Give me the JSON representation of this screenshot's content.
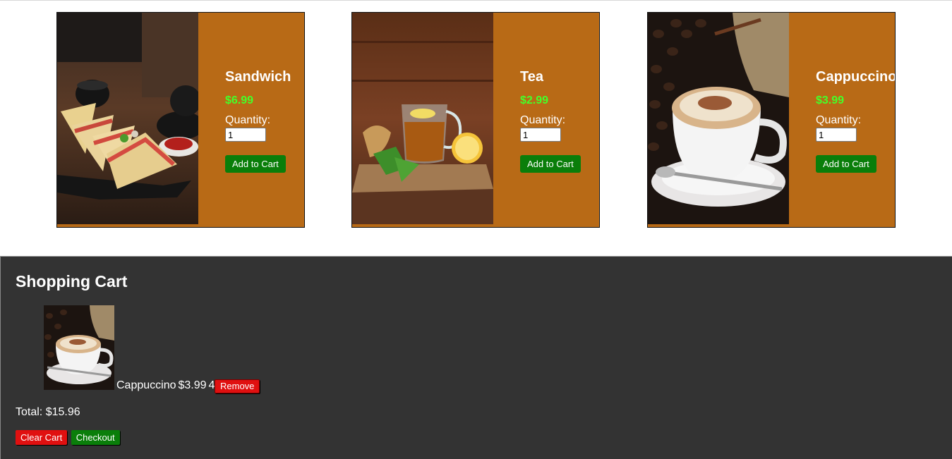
{
  "products": [
    {
      "name": "Sandwich",
      "price": "$6.99",
      "quantity_label": "Quantity:",
      "quantity_value": "1",
      "add_label": "Add to Cart",
      "image": "sandwich-photo"
    },
    {
      "name": "Tea",
      "price": "$2.99",
      "quantity_label": "Quantity:",
      "quantity_value": "1",
      "add_label": "Add to Cart",
      "image": "tea-photo"
    },
    {
      "name": "Cappuccino",
      "price": "$3.99",
      "quantity_label": "Quantity:",
      "quantity_value": "1",
      "add_label": "Add to Cart",
      "image": "cappuccino-photo"
    }
  ],
  "cart": {
    "title": "Shopping Cart",
    "items": [
      {
        "name": "Cappuccino",
        "price": "$3.99",
        "quantity": "4",
        "remove_label": "Remove",
        "image": "cappuccino-thumbnail"
      }
    ],
    "total": "Total: $15.96",
    "clear_label": "Clear Cart",
    "checkout_label": "Checkout"
  },
  "colors": {
    "card_bg": "#b86a16",
    "price": "#44ff2a",
    "cart_bg": "#333333",
    "add_button": "#0a7e0a",
    "remove_button": "#e01010"
  }
}
